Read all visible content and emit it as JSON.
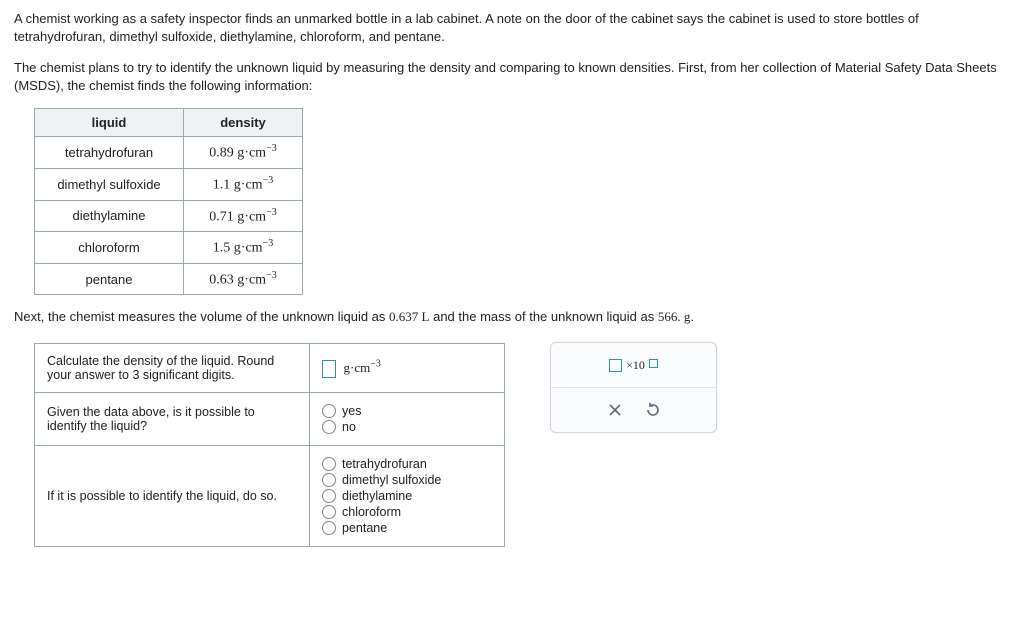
{
  "intro": {
    "p1": "A chemist working as a safety inspector finds an unmarked bottle in a lab cabinet. A note on the door of the cabinet says the cabinet is used to store bottles of tetrahydrofuran, dimethyl sulfoxide, diethylamine, chloroform, and pentane.",
    "p2": "The chemist plans to try to identify the unknown liquid by measuring the density and comparing to known densities. First, from her collection of Material Safety Data Sheets (MSDS), the chemist finds the following information:"
  },
  "table": {
    "h1": "liquid",
    "h2": "density",
    "rows": [
      {
        "liquid": "tetrahydrofuran",
        "value": "0.89"
      },
      {
        "liquid": "dimethyl sulfoxide",
        "value": "1.1"
      },
      {
        "liquid": "diethylamine",
        "value": "0.71"
      },
      {
        "liquid": "chloroform",
        "value": "1.5"
      },
      {
        "liquid": "pentane",
        "value": "0.63"
      }
    ],
    "unit_base": "g·cm",
    "unit_exp": "−3"
  },
  "measure": {
    "pre": "Next, the chemist measures the volume of the unknown liquid as ",
    "vol": "0.637 L",
    "mid": " and the mass of the unknown liquid as ",
    "mass": "566. g",
    "post": "."
  },
  "q1": {
    "text": "Calculate the density of the liquid. Round your answer to 3 significant digits.",
    "unit_base": "g·cm",
    "unit_exp": "−3"
  },
  "q2": {
    "text": "Given the data above, is it possible to identify the liquid?",
    "opt1": "yes",
    "opt2": "no"
  },
  "q3": {
    "text": "If it is possible to identify the liquid, do so.",
    "opts": [
      "tetrahydrofuran",
      "dimethyl sulfoxide",
      "diethylamine",
      "chloroform",
      "pentane"
    ]
  },
  "panel": {
    "ten_base": "×10"
  }
}
